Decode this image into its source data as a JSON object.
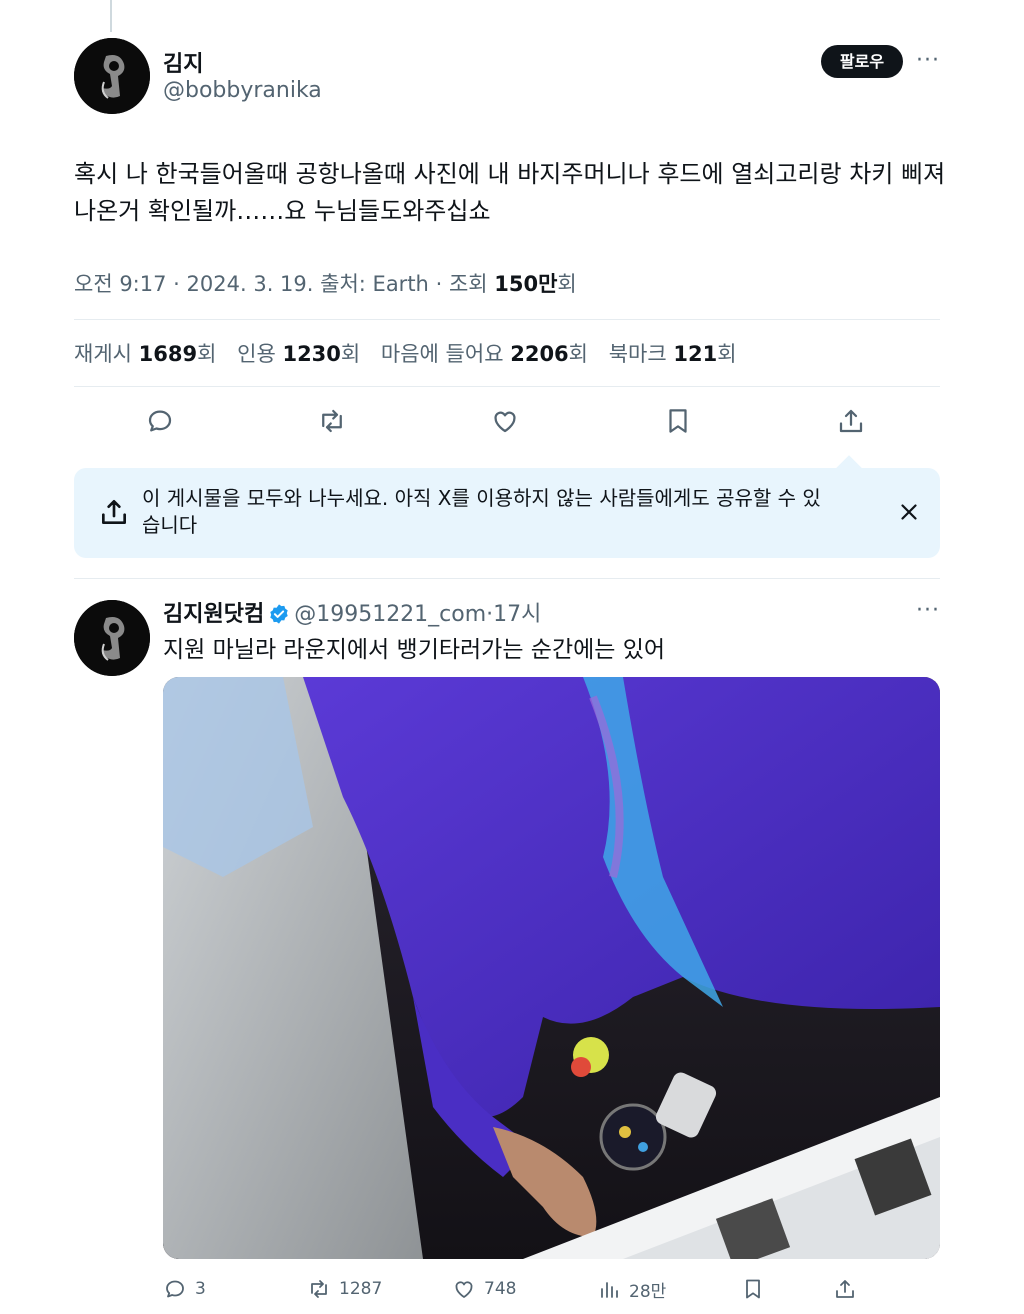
{
  "tweet": {
    "author_name": "김지",
    "author_handle": "@bobbyranika",
    "follow_label": "팔로우",
    "more_label": "···",
    "text": "혹시 나 한국들어올때 공항나올때 사진에 내 바지주머니나 후드에 열쇠고리랑 차키 삐져나온거 확인될까……요 누님들도와주십쇼",
    "time": "오전 9:17",
    "date": "2024. 3. 19.",
    "source_label": "출처:",
    "source": "Earth",
    "views_label": "조회",
    "views_value": "150만",
    "views_suffix": "회",
    "separator": "·"
  },
  "stats": {
    "reposts_label": "재게시",
    "reposts_value": "1689",
    "quotes_label": "인용",
    "quotes_value": "1230",
    "likes_label": "마음에 들어요",
    "likes_value": "2206",
    "bookmarks_label": "북마크",
    "bookmarks_value": "121",
    "suffix": "회"
  },
  "actions": [
    "reply-icon",
    "repost-icon",
    "like-icon",
    "bookmark-icon",
    "share-icon"
  ],
  "share_banner": {
    "text": "이 게시물을 모두와 나누세요. 아직 X를 이용하지 않는 사람들에게도 공유할 수 있습니다"
  },
  "quoted_tweet": {
    "author_name": "김지원닷컴",
    "author_handle": "@19951221_com",
    "separator": "·",
    "time_ago": "17시",
    "more_label": "···",
    "text": "지원 마닐라 라운지에서 뱅기타러가는 순간에는 있어",
    "reply_count": "3",
    "repost_count": "1287",
    "like_count": "748",
    "views_count": "28만"
  },
  "colors": {
    "accent": "#1d9bf0",
    "text_primary": "#0f1419",
    "text_secondary": "#536471",
    "banner_bg": "#e8f5fd",
    "follow_bg": "#0f1419"
  }
}
